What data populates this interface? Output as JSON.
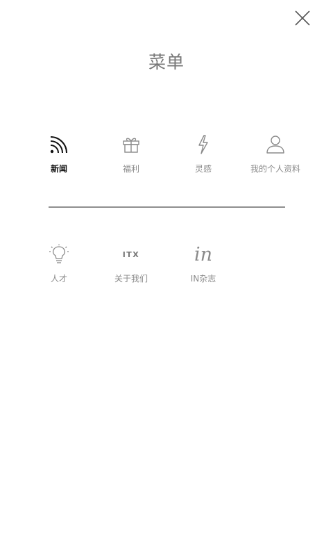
{
  "header": {
    "title": "菜单",
    "close_icon": "close-icon"
  },
  "menu": {
    "row1": [
      {
        "label": "新闻",
        "icon": "rss-feed-icon",
        "active": true
      },
      {
        "label": "福利",
        "icon": "gift-icon",
        "active": false
      },
      {
        "label": "灵感",
        "icon": "lightning-icon",
        "active": false
      },
      {
        "label": "我的个人资料",
        "icon": "user-profile-icon",
        "active": false
      }
    ],
    "row2": [
      {
        "label": "人才",
        "icon": "lightbulb-icon"
      },
      {
        "label": "关于我们",
        "icon": "itx-logo-icon",
        "logo_text": "ITX"
      },
      {
        "label": "IN杂志",
        "icon": "in-magazine-icon",
        "logo_text": "in"
      }
    ]
  },
  "colors": {
    "active_text": "#111111",
    "inactive_text": "#8a8a8a",
    "divider": "#8f8f8f",
    "background": "#ffffff"
  }
}
